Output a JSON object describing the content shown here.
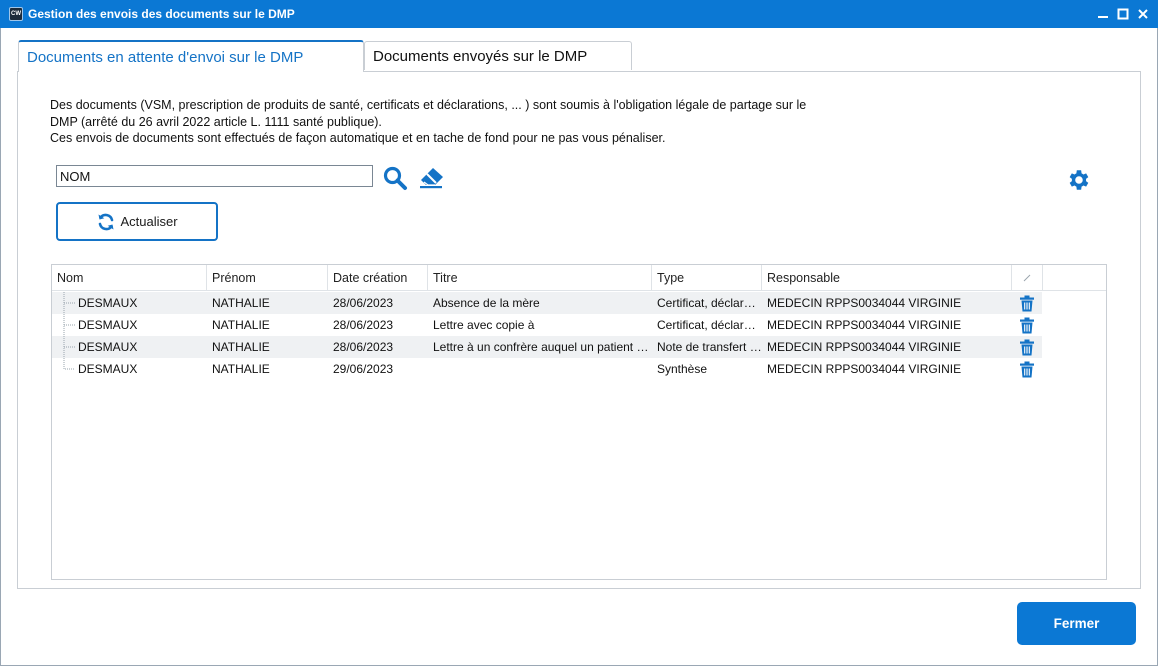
{
  "window": {
    "title": "Gestion des envois des documents sur le DMP",
    "app_icon_text": "CW"
  },
  "tabs": [
    {
      "label": "Documents en attente d'envoi sur le DMP",
      "active": true
    },
    {
      "label": "Documents envoyés sur le DMP",
      "active": false
    }
  ],
  "info": {
    "line1": "Des documents (VSM, prescription de produits de santé, certificats et déclarations, ... ) sont soumis à l'obligation légale de partage sur le",
    "line2": "DMP (arrêté du 26 avril 2022  article L. 1111 santé publique).",
    "line3": "Ces envois de documents sont effectués de façon automatique et en tache de fond pour ne pas vous pénaliser."
  },
  "search": {
    "value": "NOM"
  },
  "buttons": {
    "refresh_label": "Actualiser",
    "close_label": "Fermer"
  },
  "icons": {
    "search": "search-icon",
    "eraser": "eraser-icon",
    "settings": "gear-icon",
    "refresh": "refresh-icon",
    "trash": "trash-icon",
    "accent_color": "#1473c6"
  },
  "table": {
    "columns": [
      "Nom",
      "Prénom",
      "Date création",
      "Titre",
      "Type",
      "Responsable"
    ],
    "rows": [
      {
        "nom": "DESMAUX",
        "prenom": "NATHALIE",
        "date": "28/06/2023",
        "titre": "Absence de la mère",
        "type": "Certificat, déclarati...",
        "responsable": "MEDECIN RPPS0034044 VIRGINIE"
      },
      {
        "nom": "DESMAUX",
        "prenom": "NATHALIE",
        "date": "28/06/2023",
        "titre": "Lettre avec copie à",
        "type": "Certificat, déclarati...",
        "responsable": "MEDECIN RPPS0034044 VIRGINIE"
      },
      {
        "nom": "DESMAUX",
        "prenom": "NATHALIE",
        "date": "28/06/2023",
        "titre": "Lettre à un confrère auquel un patient es...",
        "type": "Note de transfert (...",
        "responsable": "MEDECIN RPPS0034044 VIRGINIE"
      },
      {
        "nom": "DESMAUX",
        "prenom": "NATHALIE",
        "date": "29/06/2023",
        "titre": "",
        "type": "Synthèse",
        "responsable": "MEDECIN RPPS0034044 VIRGINIE"
      }
    ]
  }
}
